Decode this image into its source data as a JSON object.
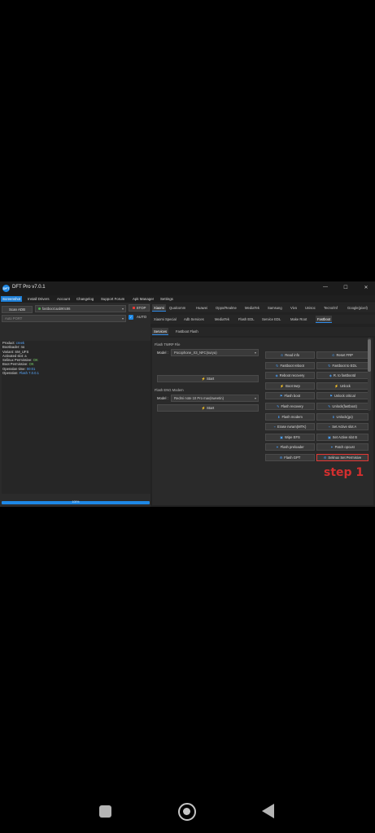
{
  "window": {
    "title": "DFT Pro v7.0.1",
    "logo_text": "DFT",
    "minimize": "—",
    "maximize": "☐",
    "close": "✕"
  },
  "menu": [
    "Screenshot",
    "Install Drivers",
    "Account",
    "Changelog",
    "Support Forum",
    "Apk Manager",
    "Settings"
  ],
  "left": {
    "scan_label": "Scan ADB",
    "device_combo": "fastboot:aab90c86",
    "port_combo": "Auto PORT",
    "stop_label": "STOP",
    "auto_label": "AUTO",
    "auto_checked": "✓",
    "log": [
      {
        "k": "Product: ",
        "v": "creek",
        "c": "v-blue"
      },
      {
        "k": "Bootloader: ",
        "v": "no",
        "c": ""
      },
      {
        "k": "Variant: ",
        "v": "SM_UFS",
        "c": ""
      },
      {
        "k": "Activated slot: ",
        "v": "a",
        "c": ""
      },
      {
        "k": "Selinux Permissive: ",
        "v": "OK",
        "c": "v-green"
      },
      {
        "k": "Boot Permissive: ",
        "v": "OK",
        "c": "v-green"
      },
      {
        "k": "Operation time: ",
        "v": "00:01",
        "c": "v-blue"
      },
      {
        "k": "Operation: ",
        "v": "Flash 7.0.0.1",
        "c": "v-blue"
      }
    ],
    "progress": "100%",
    "progress_fraction": 1.0
  },
  "tabs1": [
    "Xiaomi",
    "Qualcomm",
    "Huawei",
    "Oppo/Realme",
    "MediaTek",
    "Samsung",
    "Vivo",
    "Unisoc",
    "Tecno/Inf",
    "Google(pixel)"
  ],
  "tabs2": [
    "Xiaomi Special",
    "Adb Services",
    "MediaTek",
    "Flash EDL",
    "Service EDL",
    "Make Root",
    "Fastboot"
  ],
  "tabs3": [
    "Services",
    "Fastboot Flash"
  ],
  "twrp": {
    "group": "Flash TWRP File",
    "model_label": "Model :",
    "model_value": "Pocophone_X3_NFC(surya)",
    "start": "Start"
  },
  "eng": {
    "group": "Flash ENG Modem",
    "model_label": "Model :",
    "model_value": "Redmi note 10 Pro max(sweetin)",
    "start": "Start"
  },
  "services": [
    [
      "Read info",
      "Reset FRP"
    ],
    [
      "Fastboot reboot",
      "Fastboot to EDL"
    ],
    [
      "Reboot recovery",
      "R. to fastbootd"
    ],
    [
      "Boot twrp",
      "Unlock"
    ],
    [
      "Flash boot",
      "Unlock critical"
    ],
    [
      "Flash recovery",
      "Unlock(fastboot)"
    ],
    [
      "Flash modem",
      "Unlock(go)"
    ],
    [
      "Erase nvram(MTK)",
      "Set Active slot A"
    ],
    [
      "Wipe EFS",
      "Set Active slot B"
    ],
    [
      "Flash preloader",
      "Patch opcust"
    ],
    [
      "Flash GPT",
      "Selinux Set Permisive"
    ]
  ],
  "annotation": "step 1",
  "highlight_color": "#e53935",
  "accent_color": "#1e88e5"
}
